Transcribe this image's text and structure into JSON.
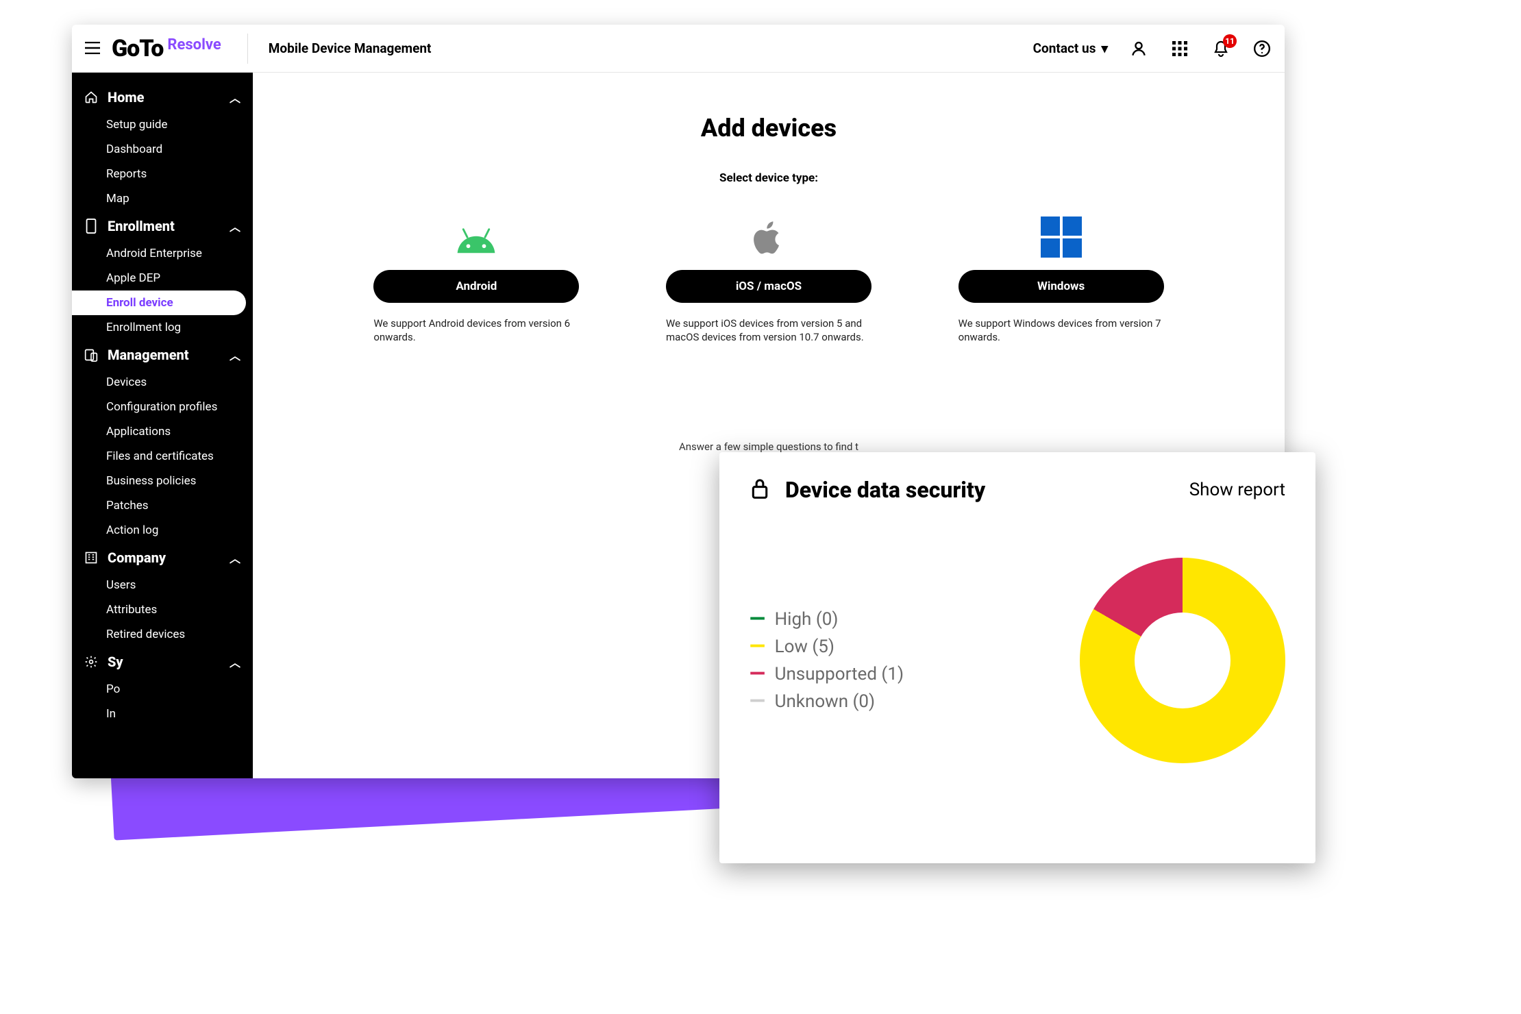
{
  "header": {
    "logo_main": "GoTo",
    "logo_sub": "Resolve",
    "page_title": "Mobile Device Management",
    "contact": "Contact us",
    "notification_count": "11"
  },
  "sidebar": {
    "groups": [
      {
        "label": "Home",
        "icon": "home",
        "items": [
          "Setup guide",
          "Dashboard",
          "Reports",
          "Map"
        ]
      },
      {
        "label": "Enrollment",
        "icon": "phone",
        "items": [
          "Android Enterprise",
          "Apple DEP",
          "Enroll device",
          "Enrollment log"
        ],
        "active": "Enroll device"
      },
      {
        "label": "Management",
        "icon": "device",
        "items": [
          "Devices",
          "Configuration profiles",
          "Applications",
          "Files and certificates",
          "Business policies",
          "Patches",
          "Action log"
        ]
      },
      {
        "label": "Company",
        "icon": "building",
        "items": [
          "Users",
          "Attributes",
          "Retired devices"
        ]
      },
      {
        "label": "Sy",
        "icon": "gear",
        "items": [
          "Po",
          "In"
        ]
      }
    ]
  },
  "main": {
    "heading": "Add devices",
    "subtitle": "Select device type:",
    "cards": [
      {
        "name": "android",
        "label": "Android",
        "desc": "We support Android devices from version 6 onwards."
      },
      {
        "name": "ios",
        "label": "iOS / macOS",
        "desc": "We support iOS devices from version 5 and macOS devices from version 10.7 onwards."
      },
      {
        "name": "windows",
        "label": "Windows",
        "desc": "We support Windows devices from version 7 onwards."
      }
    ],
    "help_line": "Answer a few simple questions to find t"
  },
  "security_panel": {
    "title": "Device data security",
    "show_report": "Show report",
    "legend": [
      {
        "label": "High",
        "count": 0,
        "color": "#008a3a"
      },
      {
        "label": "Low",
        "count": 5,
        "color": "#ffe600"
      },
      {
        "label": "Unsupported",
        "count": 1,
        "color": "#d52b5b"
      },
      {
        "label": "Unknown",
        "count": 0,
        "color": "#cfcfcf"
      }
    ]
  },
  "chart_data": {
    "type": "pie",
    "title": "Device data security",
    "series": [
      {
        "name": "High",
        "value": 0,
        "color": "#008a3a"
      },
      {
        "name": "Low",
        "value": 5,
        "color": "#ffe600"
      },
      {
        "name": "Unsupported",
        "value": 1,
        "color": "#d52b5b"
      },
      {
        "name": "Unknown",
        "value": 0,
        "color": "#cfcfcf"
      }
    ]
  }
}
